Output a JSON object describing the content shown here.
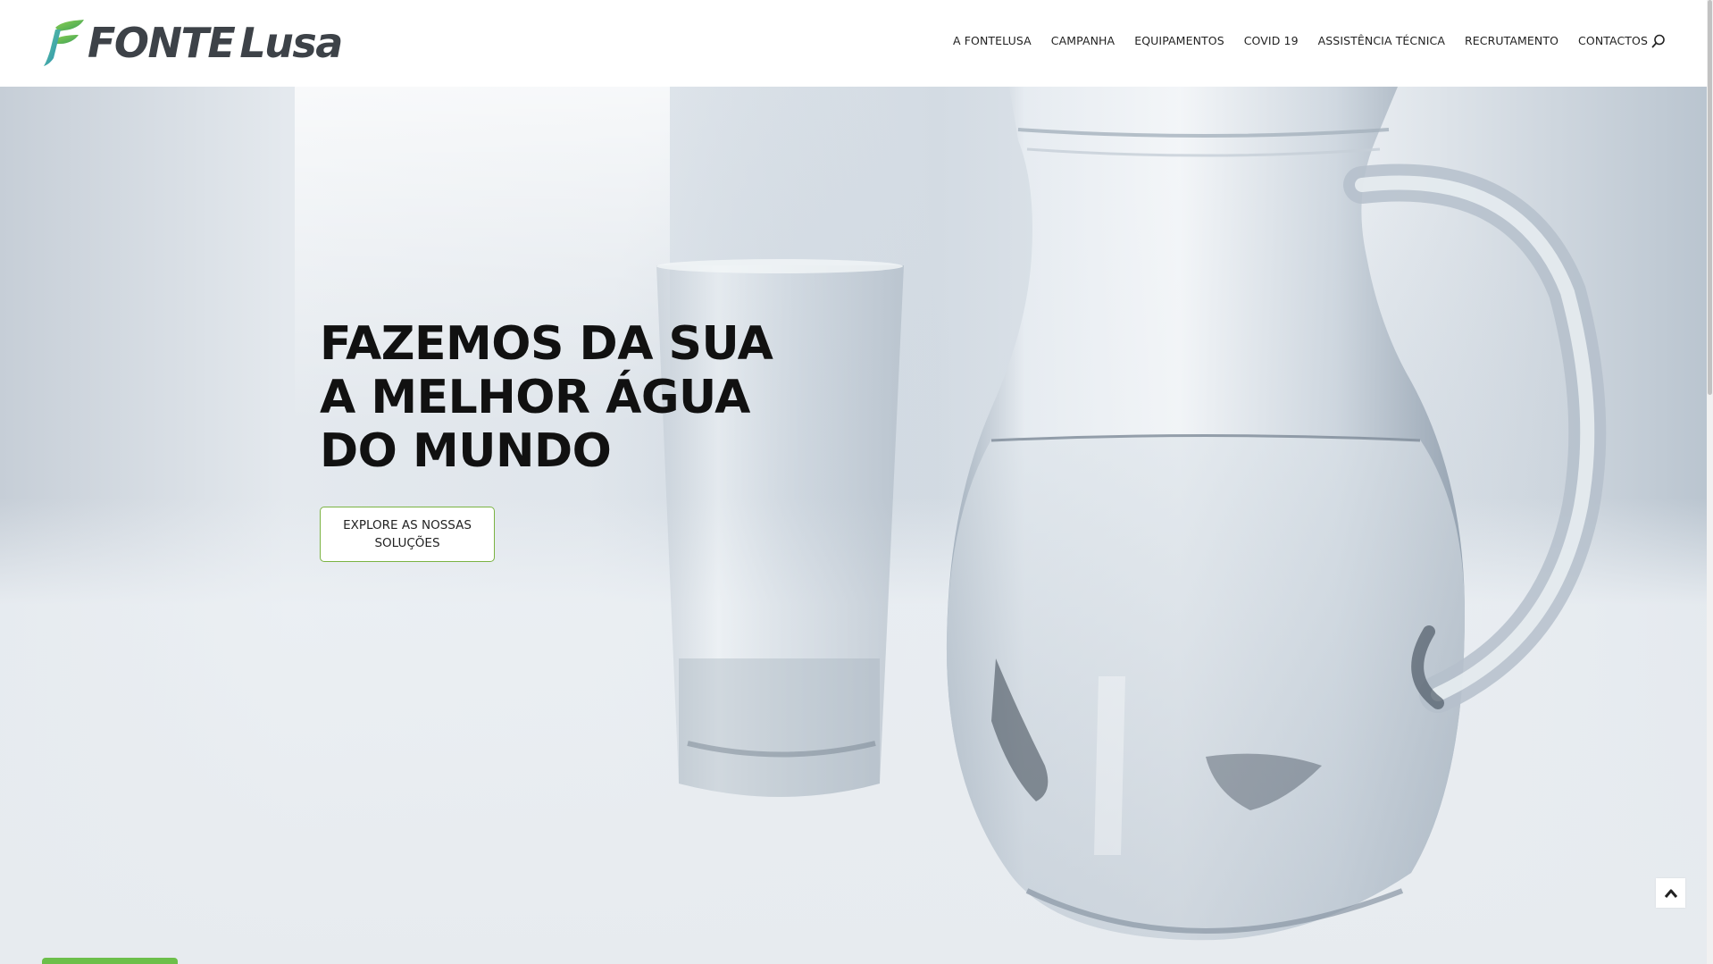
{
  "brand": {
    "name_part1": "FONTE",
    "name_part2": "Lusa",
    "logo_icon": "leaf-f-logo",
    "green": "#6cbf4a",
    "dark": "#3d4248"
  },
  "nav": {
    "items": [
      {
        "label": "A FONTELUSA"
      },
      {
        "label": "CAMPANHA"
      },
      {
        "label": "EQUIPAMENTOS"
      },
      {
        "label": "COVID 19"
      },
      {
        "label": "ASSISTÊNCIA TÉCNICA"
      },
      {
        "label": "RECRUTAMENTO"
      },
      {
        "label": "CONTACTOS"
      }
    ],
    "search_icon": "search-icon"
  },
  "hero": {
    "headline": [
      "FAZEMOS DA SUA",
      "A MELHOR ÁGUA",
      "DO MUNDO"
    ],
    "cta_label": "EXPLORE AS NOSSAS SOLUÇÕES",
    "cta_border": "#7bb342",
    "image": "glass-and-water-jug"
  },
  "controls": {
    "scroll_top_icon": "chevron-up-icon"
  }
}
